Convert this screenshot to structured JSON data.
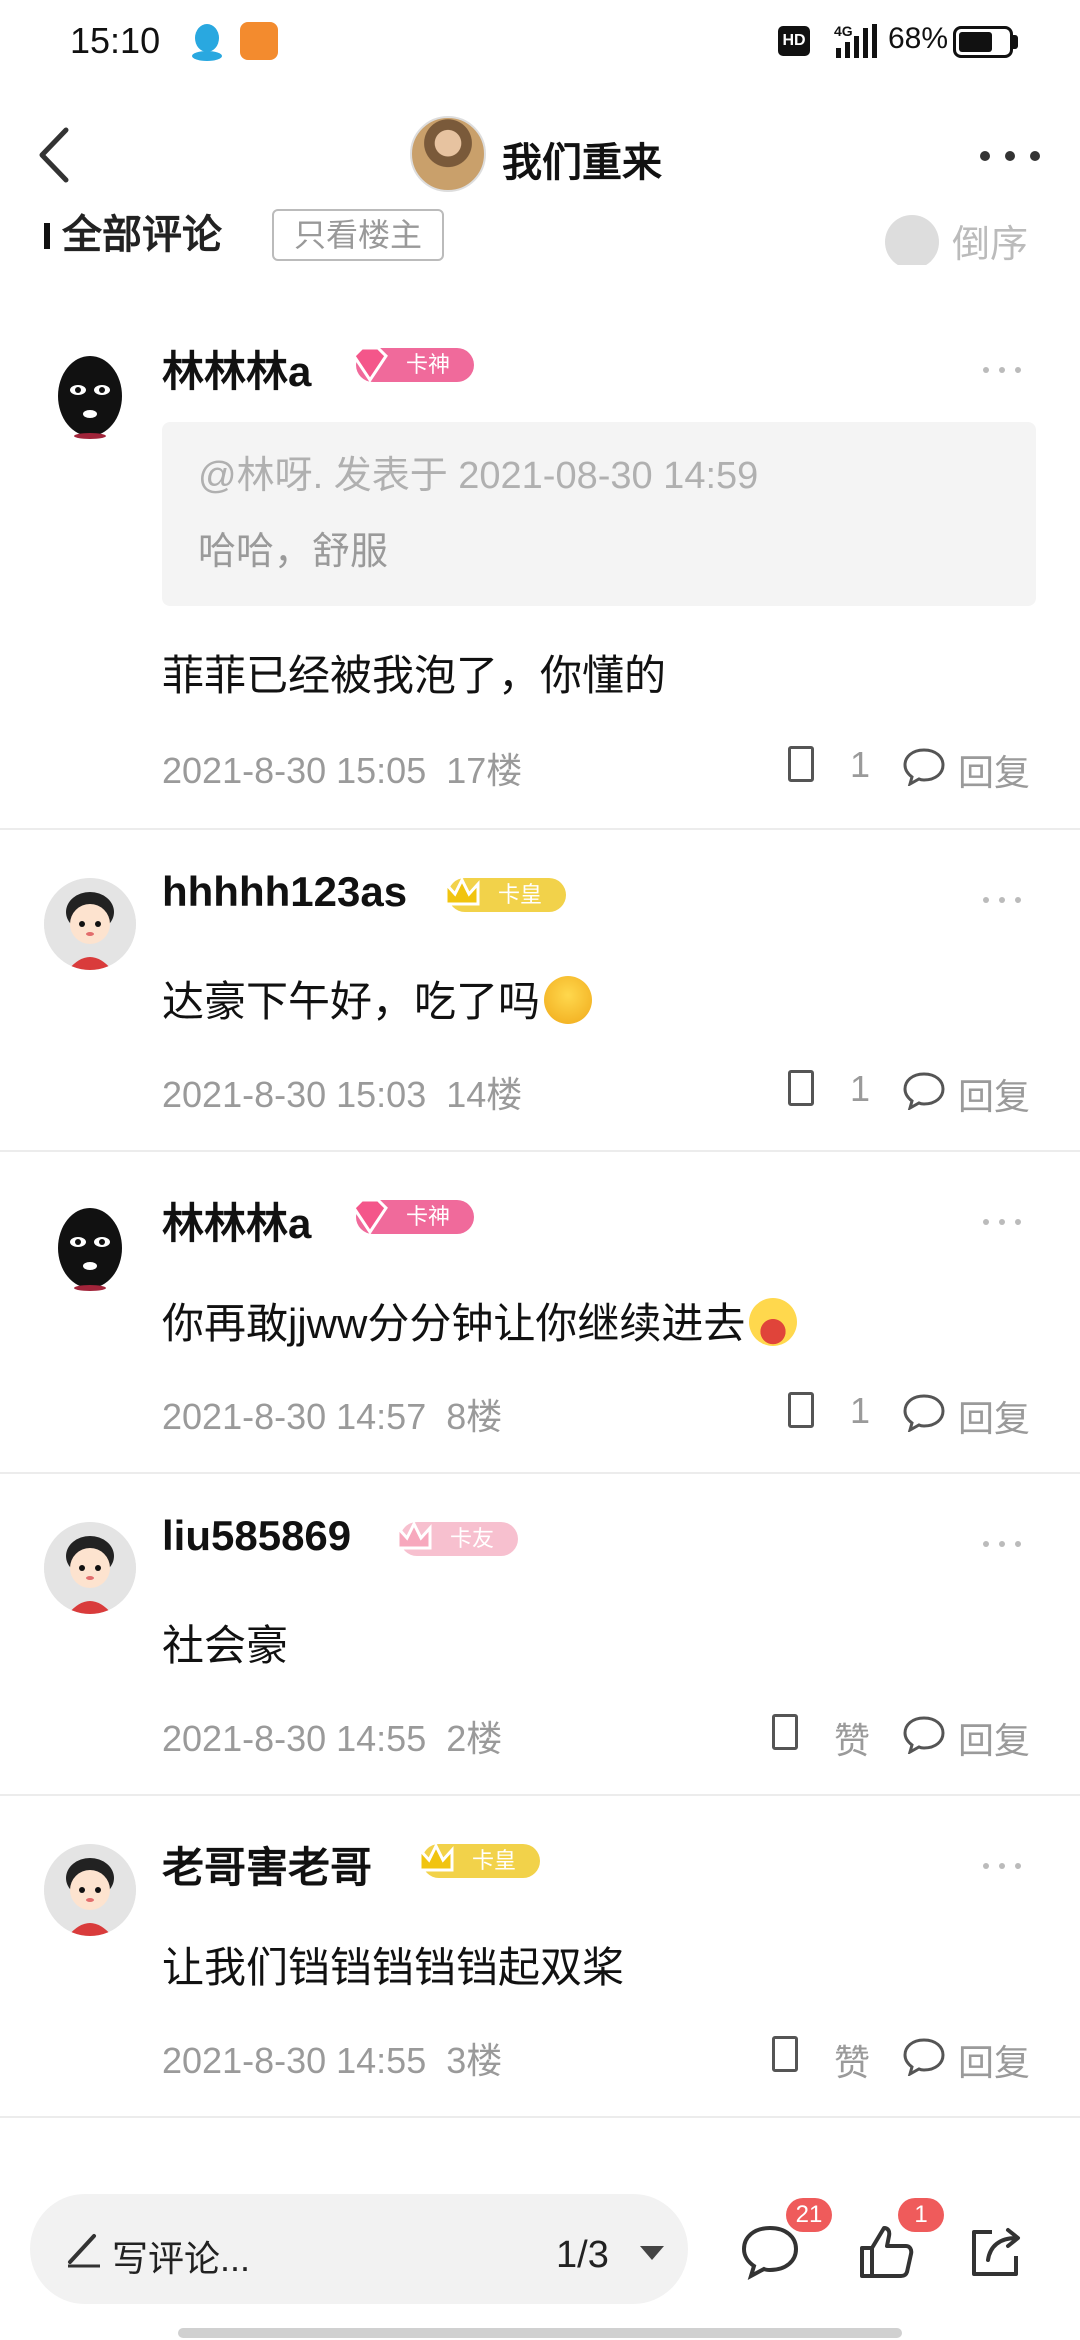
{
  "status_bar": {
    "time": "15:10",
    "network": "4G",
    "hd": "HD",
    "battery": "68%",
    "battery_level": 0.68
  },
  "header": {
    "title": "我们重来"
  },
  "filter": {
    "all_comments": "全部评论",
    "owner_only": "只看楼主",
    "sort": "倒序"
  },
  "comments": [
    {
      "username": "林林林a",
      "badge": "卡神",
      "badge_color": "#f06a9b",
      "quote_meta": "@林呀. 发表于 2021-08-30 14:59",
      "quote_text": "哈哈，舒服",
      "text": "菲菲已经被我泡了，你懂的",
      "time": "2021-8-30 15:05",
      "floor": "17楼",
      "likes": "1",
      "reply": "回复"
    },
    {
      "username": "hhhhh123as",
      "badge": "卡皇",
      "badge_color": "#f2d24a",
      "text": "达豪下午好，吃了吗",
      "time": "2021-8-30 15:03",
      "floor": "14楼",
      "likes": "1",
      "reply": "回复"
    },
    {
      "username": "林林林a",
      "badge": "卡神",
      "badge_color": "#f06a9b",
      "text": "你再敢jjww分分钟让你继续进去",
      "time": "2021-8-30 14:57",
      "floor": "8楼",
      "likes": "1",
      "reply": "回复"
    },
    {
      "username": "liu585869",
      "badge": "卡友",
      "badge_color": "#f7c0cf",
      "text": "社会豪",
      "time": "2021-8-30 14:55",
      "floor": "2楼",
      "likes": "赞",
      "reply": "回复"
    },
    {
      "username": "老哥害老哥",
      "badge": "卡皇",
      "badge_color": "#f2d24a",
      "text": "让我们铛铛铛铛铛起双桨",
      "time": "2021-8-30 14:55",
      "floor": "3楼",
      "likes": "赞",
      "reply": "回复"
    }
  ],
  "bottom_bar": {
    "compose_placeholder": "写评论...",
    "page": "1/3",
    "comment_count": "21",
    "like_count": "1"
  }
}
